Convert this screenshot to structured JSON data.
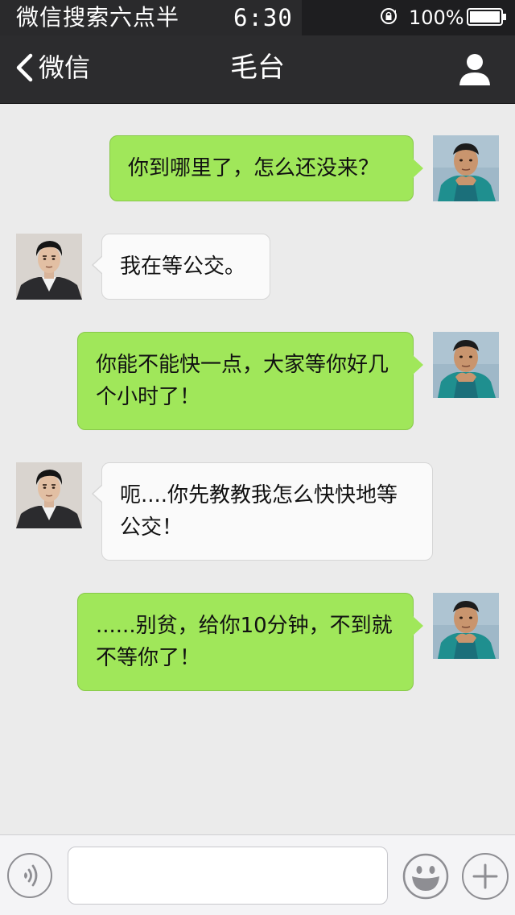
{
  "status_bar": {
    "carrier": "微信搜索六点半",
    "time": "6:30",
    "battery": "100%",
    "icons": [
      "rotation-lock-icon",
      "battery-icon"
    ]
  },
  "nav": {
    "back_label": "微信",
    "title": "毛台",
    "icons": [
      "chevron-left-icon",
      "person-icon"
    ]
  },
  "messages": [
    {
      "side": "outgoing",
      "text": "你到哪里了，怎么还没来？"
    },
    {
      "side": "incoming",
      "text": "我在等公交。"
    },
    {
      "side": "outgoing",
      "text": "你能不能快一点，大家等你好几个小时了！"
    },
    {
      "side": "incoming",
      "text": "呃....你先教教我怎么快快地等公交！"
    },
    {
      "side": "outgoing",
      "text": "......别贫，给你10分钟，不到就不等你了！"
    }
  ],
  "input_bar": {
    "value": "",
    "placeholder": "",
    "icons": [
      "voice-icon",
      "emoji-icon",
      "plus-icon"
    ]
  },
  "colors": {
    "outgoing_bubble": "#a0e75a",
    "incoming_bubble": "#fafafa",
    "nav_bg": "#2c2c2e",
    "chat_bg": "#ebebeb"
  }
}
